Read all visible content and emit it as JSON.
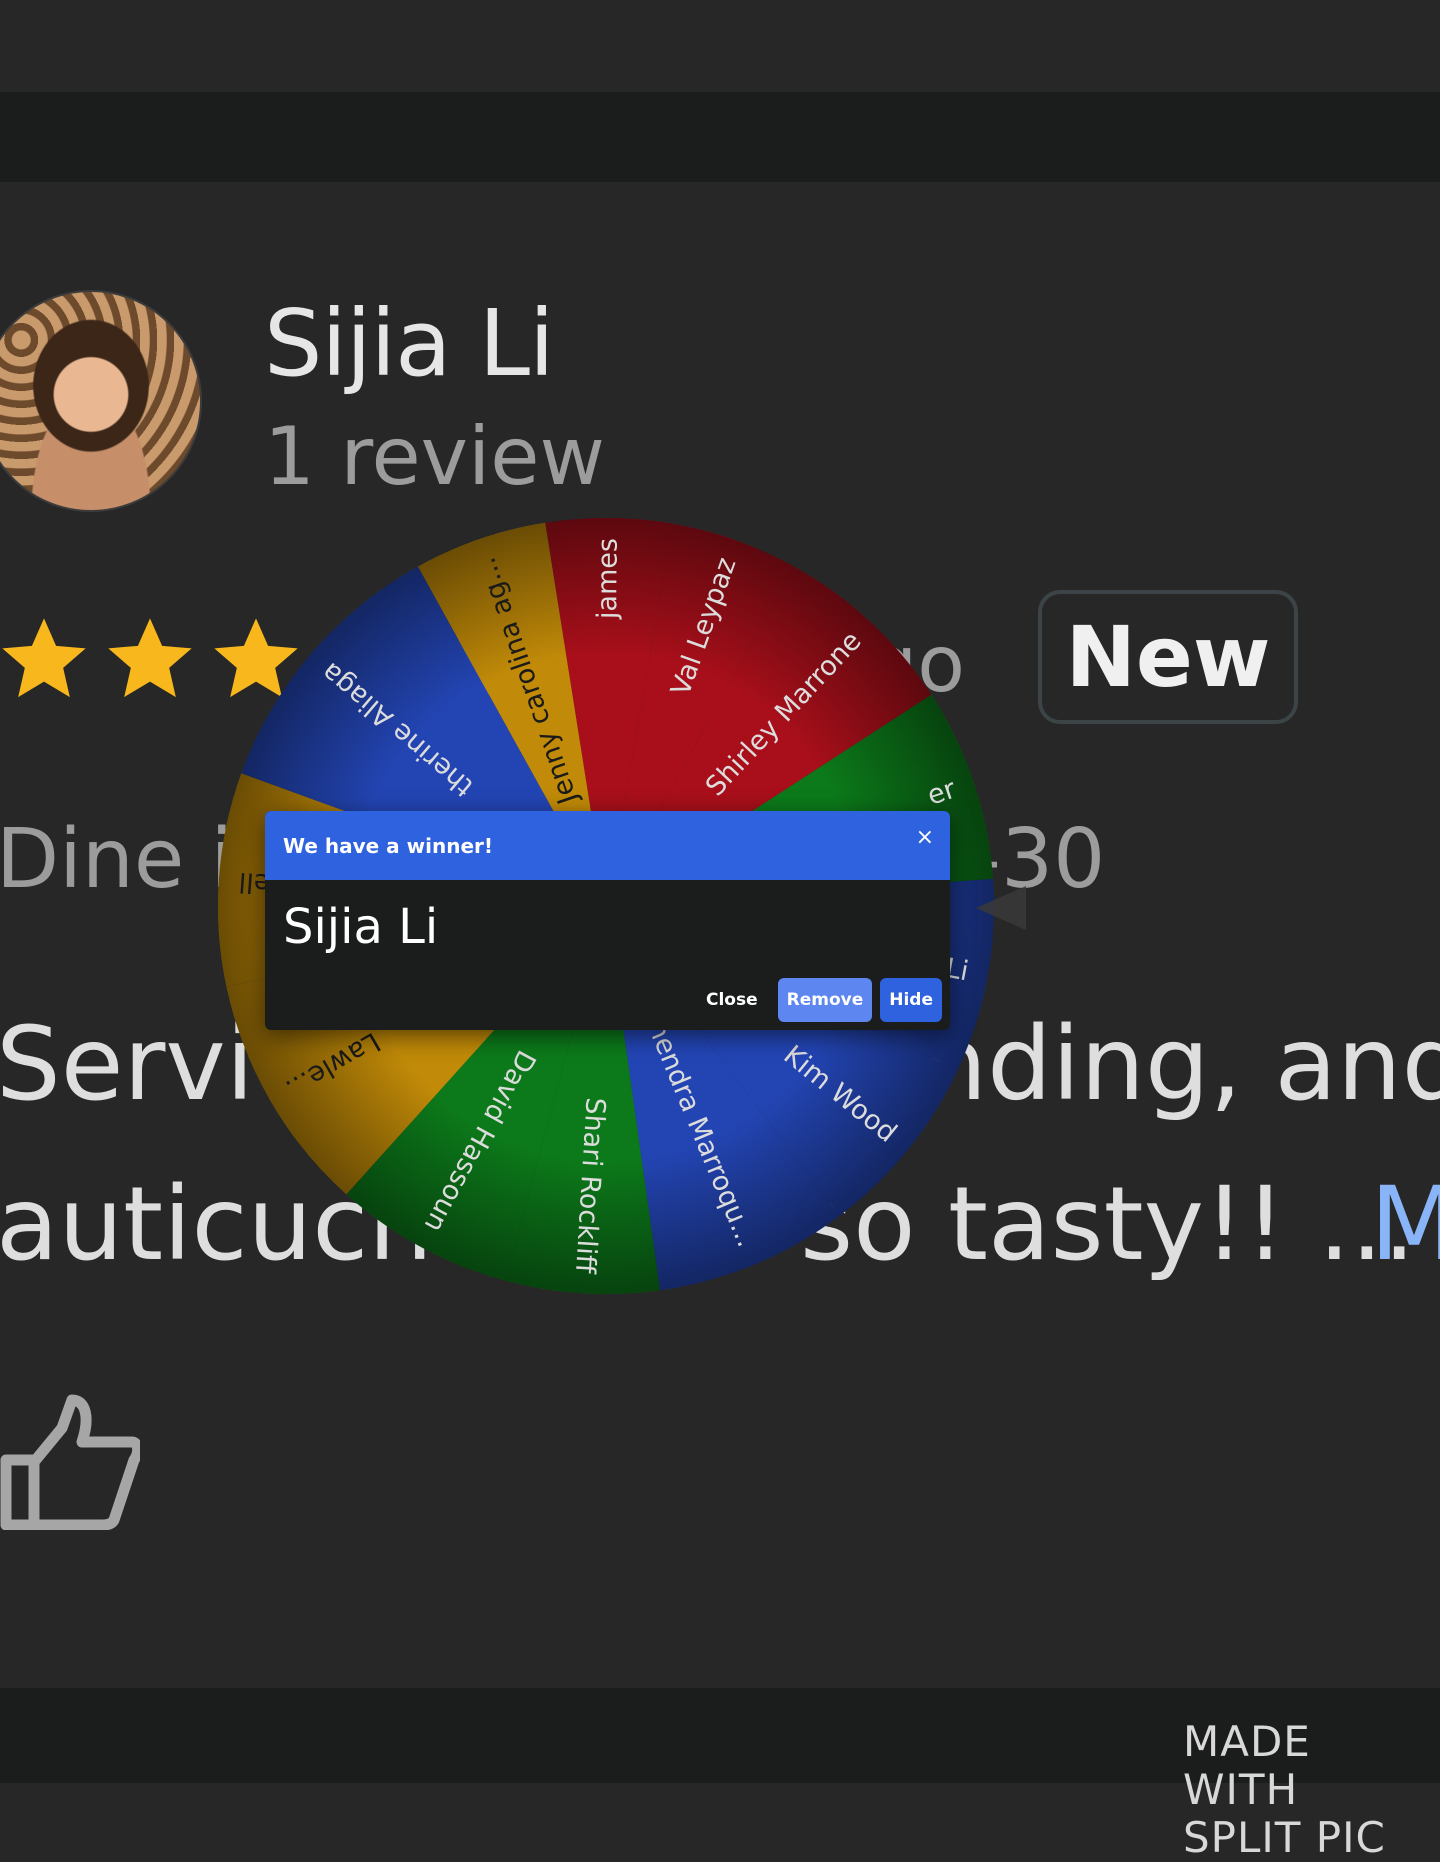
{
  "review": {
    "reviewer_name": "Sijia Li",
    "review_count": "1 review",
    "rating": 5,
    "rating_max": 5,
    "time_fragment": "ago",
    "new_badge": "New",
    "dine_prefix": "Dine in",
    "dine_range": "–30",
    "line1_start": "Servic",
    "line1_end": "anding, and",
    "line2_start": "auticucho",
    "line2_end": "so tasty!! ...",
    "more_link": "M"
  },
  "wheel": {
    "segments": [
      {
        "label": "Jenny carolina ag...",
        "color": "#c18a08",
        "start": 331,
        "end": 351
      },
      {
        "label": "james",
        "color": "#a80f1a",
        "start": 351,
        "end": 10
      },
      {
        "label": "Val Leypaz",
        "color": "#a80f1a",
        "start": 10,
        "end": 29
      },
      {
        "label": "Shirley Marrone",
        "color": "#a80f1a",
        "start": 29,
        "end": 57
      },
      {
        "label": "er",
        "color": "#0c7a1a",
        "start": 57,
        "end": 86
      },
      {
        "label": "Li",
        "color": "#2345b4",
        "start": 86,
        "end": 115
      },
      {
        "label": "Kim Wood",
        "color": "#2345b4",
        "start": 115,
        "end": 143
      },
      {
        "label": "hendra Marroqu...",
        "color": "#2345b4",
        "start": 143,
        "end": 172
      },
      {
        "label": "Shari Rockliff",
        "color": "#0c7a1a",
        "start": 172,
        "end": 195
      },
      {
        "label": "David Hassoun",
        "color": "#0c7a1a",
        "start": 195,
        "end": 222
      },
      {
        "label": "Lawle...",
        "color": "#c18a08",
        "start": 222,
        "end": 258
      },
      {
        "label": "nell",
        "color": "#c18a08",
        "start": 258,
        "end": 290
      },
      {
        "label": "therine Aliaga",
        "color": "#2345b4",
        "start": 290,
        "end": 331
      }
    ]
  },
  "dialog": {
    "title": "We have a winner!",
    "close_x": "×",
    "winner": "Sijia Li",
    "close_label": "Close",
    "remove_label": "Remove",
    "hide_label": "Hide",
    "colors": {
      "header": "#2f62de",
      "remove": "#5d86f0",
      "hide": "#2f62de"
    }
  },
  "watermark": {
    "line1": "MADE WITH",
    "line2": "SPLIT PIC"
  }
}
